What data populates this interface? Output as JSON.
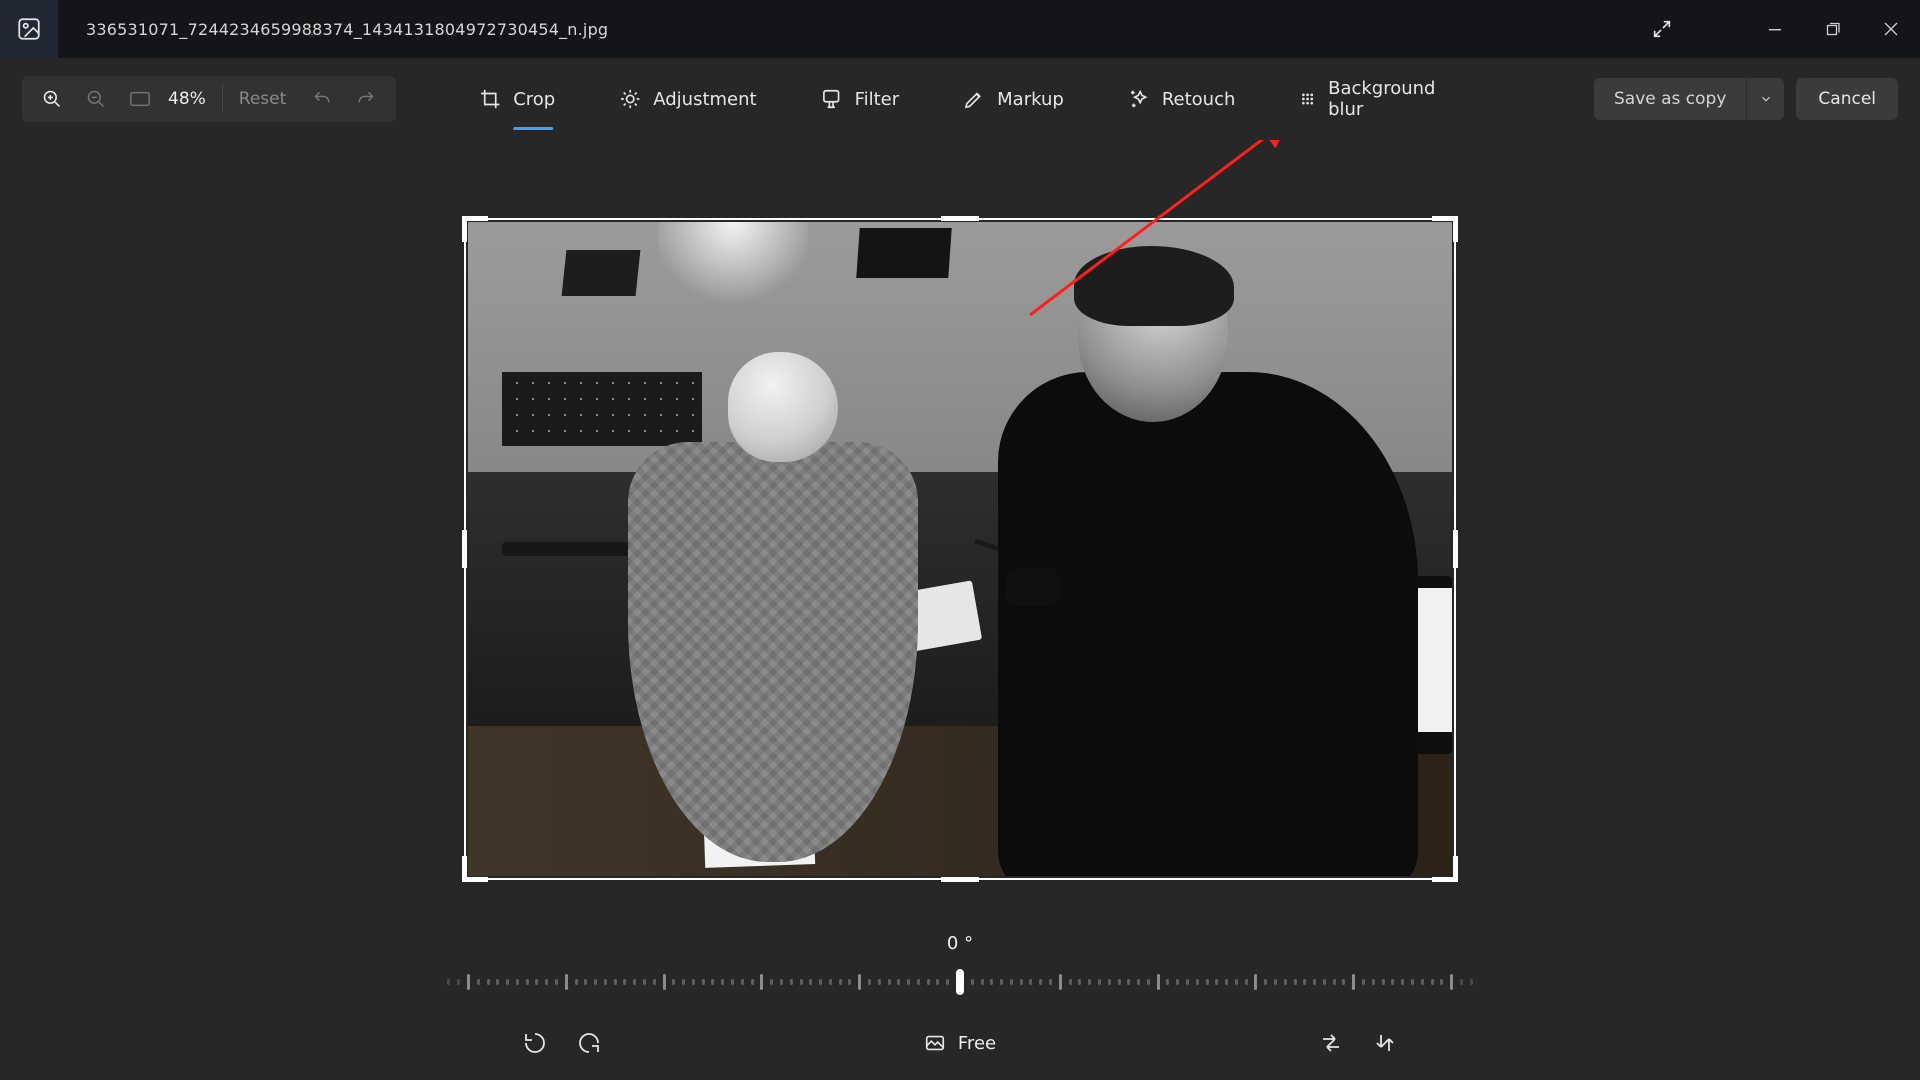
{
  "title": {
    "filename": "336531071_7244234659988374_1434131804972730454_n.jpg"
  },
  "toolbar": {
    "zoom_percent": "48%",
    "reset_label": "Reset",
    "tabs": {
      "crop": "Crop",
      "adjustment": "Adjustment",
      "filter": "Filter",
      "markup": "Markup",
      "retouch": "Retouch",
      "background_blur": "Background blur"
    },
    "save_label": "Save as copy",
    "cancel_label": "Cancel"
  },
  "rotation": {
    "degrees_label": "0 °"
  },
  "aspect": {
    "free_label": "Free"
  },
  "colors": {
    "accent": "#3aa0ff",
    "annotation": "#ff1f1f"
  }
}
